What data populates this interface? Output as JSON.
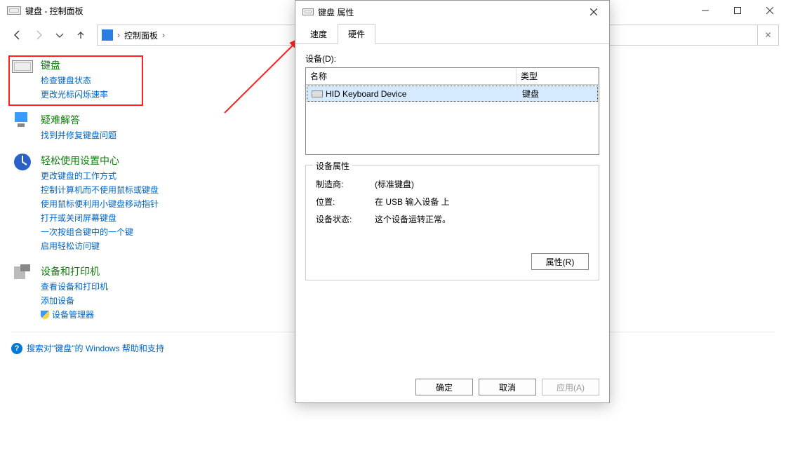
{
  "main_window": {
    "title": "键盘 - 控制面板",
    "breadcrumb": "控制面板"
  },
  "sidebar": {
    "keyboard": {
      "title": "键盘",
      "links": [
        "检查键盘状态",
        "更改光标闪烁速率"
      ]
    },
    "troubleshoot": {
      "title": "疑难解答",
      "links": [
        "找到并修复键盘问题"
      ]
    },
    "ease": {
      "title": "轻松使用设置中心",
      "links": [
        "更改键盘的工作方式",
        "控制计算机而不使用鼠标或键盘",
        "使用鼠标便利用小键盘移动指针",
        "打开或关闭屏幕键盘",
        "一次按组合键中的一个键",
        "启用轻松访问键"
      ]
    },
    "devices": {
      "title": "设备和打印机",
      "links": [
        "查看设备和打印机",
        "添加设备",
        "设备管理器"
      ]
    },
    "search_help": "搜索对\"键盘\"的 Windows 帮助和支持"
  },
  "dialog": {
    "title": "键盘 属性",
    "tabs": {
      "speed": "速度",
      "hardware": "硬件"
    },
    "devices_label": "设备(D):",
    "table": {
      "col_name": "名称",
      "col_type": "类型",
      "row": {
        "name": "HID Keyboard Device",
        "type": "键盘"
      }
    },
    "properties": {
      "group_title": "设备属性",
      "manufacturer_k": "制造商:",
      "manufacturer_v": "(标准键盘)",
      "location_k": "位置:",
      "location_v": "在 USB 输入设备 上",
      "status_k": "设备状态:",
      "status_v": "这个设备运转正常。",
      "button": "属性(R)"
    },
    "buttons": {
      "ok": "确定",
      "cancel": "取消",
      "apply": "应用(A)"
    }
  }
}
